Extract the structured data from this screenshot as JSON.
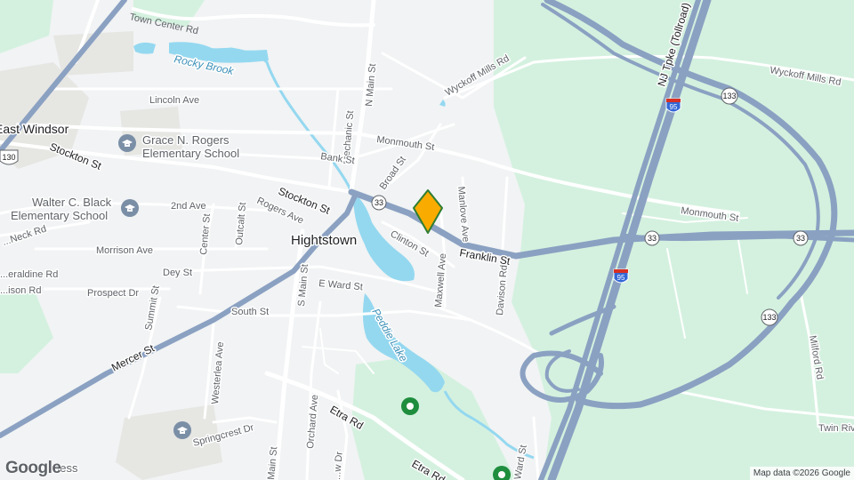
{
  "map": {
    "town_label": "Hightstown",
    "place_labels": {
      "east_windsor": "East Windsor",
      "grace_school": "Grace N. Rogers\nElementary School",
      "walter_school": "Walter C. Black\nElementary School",
      "fitness": "...ness\n...Strength"
    },
    "water_labels": {
      "rocky_brook": "Rocky Brook",
      "peddie_lake": "Peddie Lake"
    },
    "road_labels": {
      "town_center": "Town Center Rd",
      "n_main": "N Main St",
      "s_main": "S Main St",
      "s_main_lower": "Main St",
      "mechanic": "Mechanic St",
      "wyckoff_mills_west": "Wyckoff Mills Rd",
      "wyckoff_mills_east": "Wyckoff Mills Rd",
      "lincoln": "Lincoln Ave",
      "monmouth_west": "Monmouth St",
      "monmouth_east": "Monmouth St",
      "bank": "Bank St",
      "broad": "Broad St",
      "stockton_west": "Stockton St",
      "stockton_mid": "Stockton St",
      "franklin": "Franklin St",
      "manlove": "Manlove Ave",
      "second_ave": "2nd Ave",
      "rogers": "Rogers Ave",
      "outcalt": "Outcalt St",
      "center": "Center St",
      "morrison": "Morrison Ave",
      "clinton": "Clinton St",
      "maxwell": "Maxwell Ave",
      "davison": "Davison Rd",
      "dey": "Dey St",
      "prospect": "Prospect Dr",
      "e_ward": "E Ward St",
      "summit": "Summit St",
      "south": "South St",
      "neck": "...Neck Rd",
      "geraldine": "...eraldine Rd",
      "edison": "...ison Rd",
      "mercer": "Mercer St",
      "westerlea": "Westerlea Ave",
      "springcrest": "Springcrest Dr",
      "orchard": "Orchard Ave",
      "etra_lower": "Etra Rd",
      "etra_upper": "Etra Rd",
      "ward_east": "Ward St",
      "milford": "Milford Rd",
      "twin_rivers": "Twin Rive...",
      "nj_tpke": "NJ Tpke (Tollroad)",
      "view_dr": "...w Dr"
    },
    "shields": {
      "rt33_a": "33",
      "rt33_b": "33",
      "rt33_c": "33",
      "rt133_a": "133",
      "rt133_b": "133",
      "us130": "130",
      "i95_a": "95",
      "i95_b": "95"
    },
    "marker": {
      "color": "#f9ab00",
      "icon": "diamond-marker-icon"
    }
  },
  "footer": {
    "logo": "Google",
    "attribution": "Map data ©2026 Google"
  },
  "colors": {
    "land": "#f1f3f4",
    "park": "#d4f1df",
    "water": "#94d8f0",
    "highway": "#8ba1c2",
    "road": "#ffffff",
    "urban": "#e8e8e6"
  }
}
